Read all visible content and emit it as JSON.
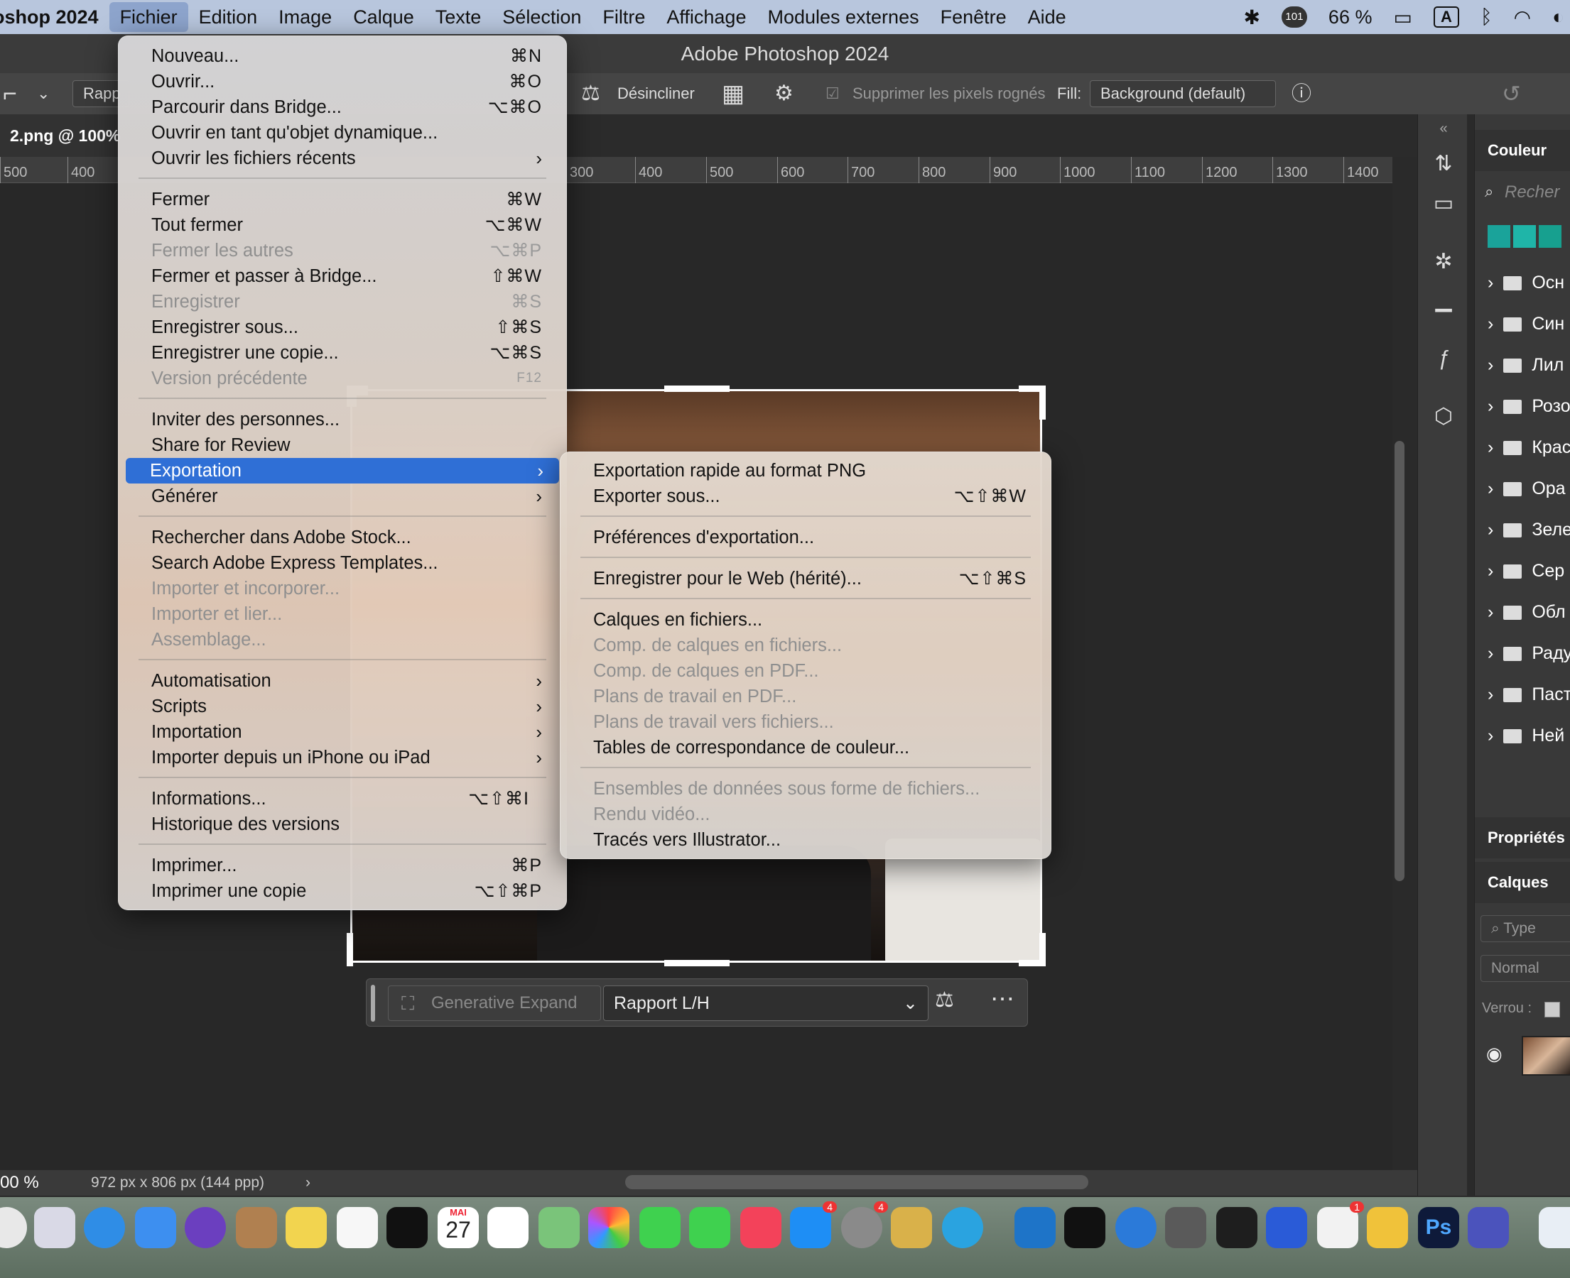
{
  "menubar": {
    "app": "oshop 2024",
    "items": [
      "Fichier",
      "Edition",
      "Image",
      "Calque",
      "Texte",
      "Sélection",
      "Filtre",
      "Affichage",
      "Modules externes",
      "Fenêtre",
      "Aide"
    ],
    "badge": "101",
    "battery": "66 %",
    "input_source": "A"
  },
  "window": {
    "title": "Adobe Photoshop 2024"
  },
  "options": {
    "ratio_partial": "Rapp",
    "straighten": "Désincliner",
    "delete_cropped": "Supprimer les pixels rognés",
    "fill_label": "Fill:",
    "fill_value": "Background (default)"
  },
  "document": {
    "tab": "2.png @ 100%"
  },
  "ruler": [
    "500",
    "400",
    "300",
    "400",
    "500",
    "600",
    "700",
    "800",
    "900",
    "1000",
    "1100",
    "1200",
    "1300",
    "1400"
  ],
  "file_menu": {
    "groups": [
      [
        {
          "label": "Nouveau...",
          "shortcut": "⌘N"
        },
        {
          "label": "Ouvrir...",
          "shortcut": "⌘O"
        },
        {
          "label": "Parcourir dans Bridge...",
          "shortcut": "⌥⌘O"
        },
        {
          "label": "Ouvrir en tant qu'objet dynamique...",
          "shortcut": ""
        },
        {
          "label": "Ouvrir les fichiers récents",
          "shortcut": "",
          "submenu": true
        }
      ],
      [
        {
          "label": "Fermer",
          "shortcut": "⌘W"
        },
        {
          "label": "Tout fermer",
          "shortcut": "⌥⌘W"
        },
        {
          "label": "Fermer les autres",
          "shortcut": "⌥⌘P",
          "disabled": true
        },
        {
          "label": "Fermer et passer à Bridge...",
          "shortcut": "⇧⌘W"
        },
        {
          "label": "Enregistrer",
          "shortcut": "⌘S",
          "disabled": true
        },
        {
          "label": "Enregistrer sous...",
          "shortcut": "⇧⌘S"
        },
        {
          "label": "Enregistrer une copie...",
          "shortcut": "⌥⌘S"
        },
        {
          "label": "Version précédente",
          "shortcut": "F12",
          "disabled": true
        }
      ],
      [
        {
          "label": "Inviter des personnes...",
          "shortcut": ""
        },
        {
          "label": "Share for Review",
          "shortcut": ""
        },
        {
          "label": "Exportation",
          "shortcut": "",
          "submenu": true,
          "highlighted": true
        },
        {
          "label": "Générer",
          "shortcut": "",
          "submenu": true
        }
      ],
      [
        {
          "label": "Rechercher dans Adobe Stock...",
          "shortcut": ""
        },
        {
          "label": "Search Adobe Express Templates...",
          "shortcut": ""
        },
        {
          "label": "Importer et incorporer...",
          "shortcut": "",
          "disabled": true
        },
        {
          "label": "Importer et lier...",
          "shortcut": "",
          "disabled": true
        },
        {
          "label": "Assemblage...",
          "shortcut": "",
          "disabled": true
        }
      ],
      [
        {
          "label": "Automatisation",
          "shortcut": "",
          "submenu": true
        },
        {
          "label": "Scripts",
          "shortcut": "",
          "submenu": true
        },
        {
          "label": "Importation",
          "shortcut": "",
          "submenu": true
        },
        {
          "label": "Importer depuis un iPhone ou iPad",
          "shortcut": "",
          "submenu": true
        }
      ],
      [
        {
          "label": "Informations...",
          "shortcut": "⌥⇧⌘I"
        },
        {
          "label": "Historique des versions",
          "shortcut": ""
        }
      ],
      [
        {
          "label": "Imprimer...",
          "shortcut": "⌘P"
        },
        {
          "label": "Imprimer une copie",
          "shortcut": "⌥⇧⌘P"
        }
      ]
    ]
  },
  "export_menu": {
    "groups": [
      [
        {
          "label": "Exportation rapide au format PNG",
          "shortcut": ""
        },
        {
          "label": "Exporter sous...",
          "shortcut": "⌥⇧⌘W"
        }
      ],
      [
        {
          "label": "Préférences d'exportation...",
          "shortcut": ""
        }
      ],
      [
        {
          "label": "Enregistrer pour le Web (hérité)...",
          "shortcut": "⌥⇧⌘S"
        }
      ],
      [
        {
          "label": "Calques en fichiers...",
          "shortcut": ""
        },
        {
          "label": "Comp. de calques en fichiers...",
          "shortcut": "",
          "disabled": true
        },
        {
          "label": "Comp. de calques en PDF...",
          "shortcut": "",
          "disabled": true
        },
        {
          "label": "Plans de travail en PDF...",
          "shortcut": "",
          "disabled": true
        },
        {
          "label": "Plans de travail vers fichiers...",
          "shortcut": "",
          "disabled": true
        },
        {
          "label": "Tables de correspondance de couleur...",
          "shortcut": ""
        }
      ],
      [
        {
          "label": "Ensembles de données sous forme de fichiers...",
          "shortcut": "",
          "disabled": true
        },
        {
          "label": "Rendu vidéo...",
          "shortcut": "",
          "disabled": true
        },
        {
          "label": "Tracés vers Illustrator...",
          "shortcut": ""
        }
      ]
    ]
  },
  "gen_bar": {
    "generative_expand": "Generative Expand",
    "ratio": "Rapport L/H"
  },
  "status": {
    "zoom": "00 %",
    "doc_info": "972 px x 806 px (144 ppp)"
  },
  "panels": {
    "color_tab": "Couleur",
    "search_placeholder": "Recher",
    "folders": [
      "Осн",
      "Син",
      "Лил",
      "Розо",
      "Крас",
      "Ора",
      "Зеле",
      "Сер",
      "Обл",
      "Раду",
      "Паст",
      "Ней"
    ],
    "properties_tab": "Propriétés",
    "layers_tab": "Calques",
    "layer_search": "Type",
    "blend_mode": "Normal",
    "lock_label": "Verrou :"
  },
  "dock": {
    "calendar_month": "MAI",
    "calendar_day": "27",
    "appstore_badge": "4",
    "settings_badge": "4",
    "office_badge": "1"
  },
  "colors": {
    "highlight": "#2f6fd6",
    "menubar": "#b8c6dd",
    "swatches": [
      "#1aa39a",
      "#1fb5a8",
      "#17a08f"
    ]
  }
}
